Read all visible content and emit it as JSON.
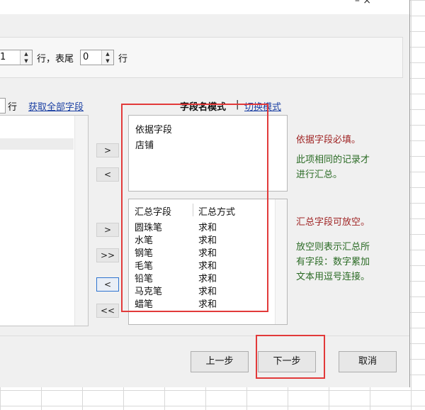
{
  "title_controls": "– ×",
  "header_row": {
    "spin1_value": "1",
    "row_label": "行，表尾",
    "spin2_value": "0",
    "row_label_end": "行"
  },
  "field_row": {
    "row_suffix": "行",
    "get_all_fields_link": "获取全部字段",
    "mode_current": "字段名模式",
    "mode_separator": "|",
    "switch_mode_link": "切换模式"
  },
  "buttons": {
    "add_basis": ">",
    "remove_basis": "<",
    "add_agg": ">",
    "add_all_agg": ">>",
    "remove_agg": "<",
    "remove_all_agg": "<<"
  },
  "basis_panel": {
    "title": "依据字段",
    "items": [
      "店铺"
    ]
  },
  "aggregate_panel": {
    "col_field": "汇总字段",
    "col_method": "汇总方式",
    "rows": [
      {
        "name": "圆珠笔",
        "method": "求和"
      },
      {
        "name": "水笔",
        "method": "求和"
      },
      {
        "name": "钢笔",
        "method": "求和"
      },
      {
        "name": "毛笔",
        "method": "求和"
      },
      {
        "name": "铅笔",
        "method": "求和"
      },
      {
        "name": "马克笔",
        "method": "求和"
      },
      {
        "name": "蜡笔",
        "method": "求和"
      }
    ]
  },
  "notes": {
    "basis_required": "依据字段必填。",
    "basis_desc_1": "此项相同的记录才",
    "basis_desc_2": "进行汇总。",
    "agg_optional": "汇总字段可放空。",
    "agg_desc_1": "放空则表示汇总所",
    "agg_desc_2": "有字段：数字累加",
    "agg_desc_3": "文本用逗号连接。"
  },
  "footer": {
    "prev": "上一步",
    "next": "下一步",
    "cancel": "取消"
  },
  "colors": {
    "highlight_box": "#e23a3a",
    "link": "#1a3fa3",
    "note_red": "#a02626",
    "note_green": "#2b6b25"
  }
}
